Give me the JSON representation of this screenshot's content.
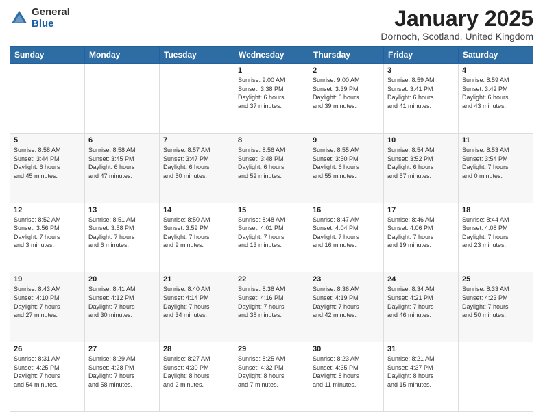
{
  "logo": {
    "general": "General",
    "blue": "Blue"
  },
  "title": "January 2025",
  "location": "Dornoch, Scotland, United Kingdom",
  "days_header": [
    "Sunday",
    "Monday",
    "Tuesday",
    "Wednesday",
    "Thursday",
    "Friday",
    "Saturday"
  ],
  "weeks": [
    [
      {
        "day": "",
        "info": ""
      },
      {
        "day": "",
        "info": ""
      },
      {
        "day": "",
        "info": ""
      },
      {
        "day": "1",
        "info": "Sunrise: 9:00 AM\nSunset: 3:38 PM\nDaylight: 6 hours\nand 37 minutes."
      },
      {
        "day": "2",
        "info": "Sunrise: 9:00 AM\nSunset: 3:39 PM\nDaylight: 6 hours\nand 39 minutes."
      },
      {
        "day": "3",
        "info": "Sunrise: 8:59 AM\nSunset: 3:41 PM\nDaylight: 6 hours\nand 41 minutes."
      },
      {
        "day": "4",
        "info": "Sunrise: 8:59 AM\nSunset: 3:42 PM\nDaylight: 6 hours\nand 43 minutes."
      }
    ],
    [
      {
        "day": "5",
        "info": "Sunrise: 8:58 AM\nSunset: 3:44 PM\nDaylight: 6 hours\nand 45 minutes."
      },
      {
        "day": "6",
        "info": "Sunrise: 8:58 AM\nSunset: 3:45 PM\nDaylight: 6 hours\nand 47 minutes."
      },
      {
        "day": "7",
        "info": "Sunrise: 8:57 AM\nSunset: 3:47 PM\nDaylight: 6 hours\nand 50 minutes."
      },
      {
        "day": "8",
        "info": "Sunrise: 8:56 AM\nSunset: 3:48 PM\nDaylight: 6 hours\nand 52 minutes."
      },
      {
        "day": "9",
        "info": "Sunrise: 8:55 AM\nSunset: 3:50 PM\nDaylight: 6 hours\nand 55 minutes."
      },
      {
        "day": "10",
        "info": "Sunrise: 8:54 AM\nSunset: 3:52 PM\nDaylight: 6 hours\nand 57 minutes."
      },
      {
        "day": "11",
        "info": "Sunrise: 8:53 AM\nSunset: 3:54 PM\nDaylight: 7 hours\nand 0 minutes."
      }
    ],
    [
      {
        "day": "12",
        "info": "Sunrise: 8:52 AM\nSunset: 3:56 PM\nDaylight: 7 hours\nand 3 minutes."
      },
      {
        "day": "13",
        "info": "Sunrise: 8:51 AM\nSunset: 3:58 PM\nDaylight: 7 hours\nand 6 minutes."
      },
      {
        "day": "14",
        "info": "Sunrise: 8:50 AM\nSunset: 3:59 PM\nDaylight: 7 hours\nand 9 minutes."
      },
      {
        "day": "15",
        "info": "Sunrise: 8:48 AM\nSunset: 4:01 PM\nDaylight: 7 hours\nand 13 minutes."
      },
      {
        "day": "16",
        "info": "Sunrise: 8:47 AM\nSunset: 4:04 PM\nDaylight: 7 hours\nand 16 minutes."
      },
      {
        "day": "17",
        "info": "Sunrise: 8:46 AM\nSunset: 4:06 PM\nDaylight: 7 hours\nand 19 minutes."
      },
      {
        "day": "18",
        "info": "Sunrise: 8:44 AM\nSunset: 4:08 PM\nDaylight: 7 hours\nand 23 minutes."
      }
    ],
    [
      {
        "day": "19",
        "info": "Sunrise: 8:43 AM\nSunset: 4:10 PM\nDaylight: 7 hours\nand 27 minutes."
      },
      {
        "day": "20",
        "info": "Sunrise: 8:41 AM\nSunset: 4:12 PM\nDaylight: 7 hours\nand 30 minutes."
      },
      {
        "day": "21",
        "info": "Sunrise: 8:40 AM\nSunset: 4:14 PM\nDaylight: 7 hours\nand 34 minutes."
      },
      {
        "day": "22",
        "info": "Sunrise: 8:38 AM\nSunset: 4:16 PM\nDaylight: 7 hours\nand 38 minutes."
      },
      {
        "day": "23",
        "info": "Sunrise: 8:36 AM\nSunset: 4:19 PM\nDaylight: 7 hours\nand 42 minutes."
      },
      {
        "day": "24",
        "info": "Sunrise: 8:34 AM\nSunset: 4:21 PM\nDaylight: 7 hours\nand 46 minutes."
      },
      {
        "day": "25",
        "info": "Sunrise: 8:33 AM\nSunset: 4:23 PM\nDaylight: 7 hours\nand 50 minutes."
      }
    ],
    [
      {
        "day": "26",
        "info": "Sunrise: 8:31 AM\nSunset: 4:25 PM\nDaylight: 7 hours\nand 54 minutes."
      },
      {
        "day": "27",
        "info": "Sunrise: 8:29 AM\nSunset: 4:28 PM\nDaylight: 7 hours\nand 58 minutes."
      },
      {
        "day": "28",
        "info": "Sunrise: 8:27 AM\nSunset: 4:30 PM\nDaylight: 8 hours\nand 2 minutes."
      },
      {
        "day": "29",
        "info": "Sunrise: 8:25 AM\nSunset: 4:32 PM\nDaylight: 8 hours\nand 7 minutes."
      },
      {
        "day": "30",
        "info": "Sunrise: 8:23 AM\nSunset: 4:35 PM\nDaylight: 8 hours\nand 11 minutes."
      },
      {
        "day": "31",
        "info": "Sunrise: 8:21 AM\nSunset: 4:37 PM\nDaylight: 8 hours\nand 15 minutes."
      },
      {
        "day": "",
        "info": ""
      }
    ]
  ]
}
